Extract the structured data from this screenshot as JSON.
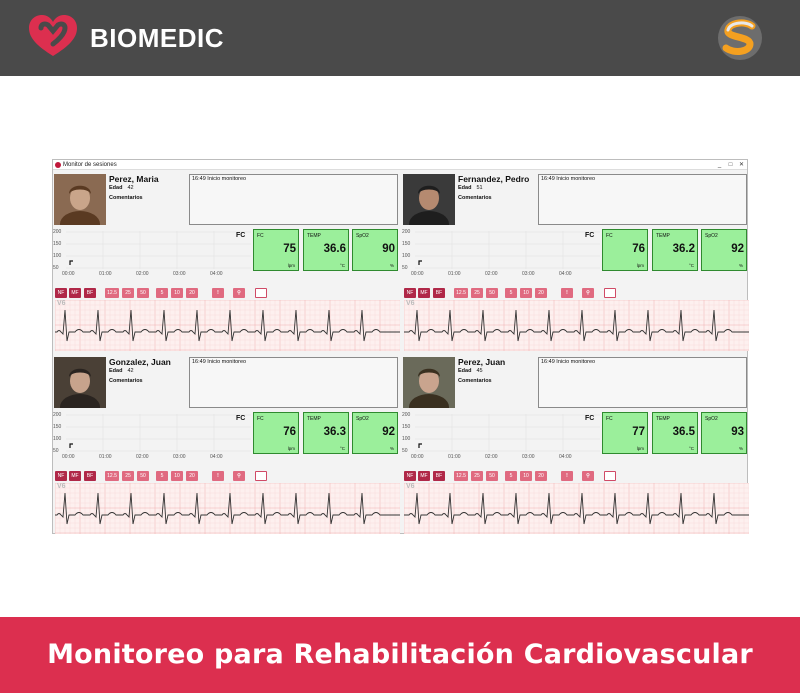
{
  "brand": {
    "name": "BIOMEDIC",
    "color": "#dc2f4f"
  },
  "footer": {
    "text": "Monitoreo para Rehabilitación Cardiovascular"
  },
  "window": {
    "title": "Monitor de sesiones",
    "minimize": "_",
    "maximize": "□",
    "close": "✕"
  },
  "panel_labels": {
    "age_label": "Edad",
    "comments_label": "Comentarios",
    "fc_title": "FC",
    "y_ticks": [
      "200",
      "150",
      "100",
      "50"
    ],
    "x_ticks": [
      "00:00",
      "01:00",
      "02:00",
      "03:00",
      "04:00"
    ],
    "vital_fc": {
      "label": "FC",
      "unit": "lpm"
    },
    "vital_temp": {
      "label": "TEMP",
      "unit": "°C"
    },
    "vital_spo2": {
      "label": "SpO2",
      "unit": "%"
    },
    "ecg_lead": "V6",
    "toolbar": [
      "NF",
      "MF",
      "BF",
      "12.5",
      "25",
      "50",
      "5",
      "10",
      "20",
      "!",
      "⚲",
      ""
    ]
  },
  "patients": [
    {
      "name": "Perez, Maria",
      "age": "42",
      "log": "16:49 Inicio monitoreo",
      "fc": "75",
      "temp": "36.6",
      "spo2": "90"
    },
    {
      "name": "Fernandez, Pedro",
      "age": "51",
      "log": "16:49 Inicio monitoreo",
      "fc": "76",
      "temp": "36.2",
      "spo2": "92"
    },
    {
      "name": "Gonzalez, Juan",
      "age": "42",
      "log": "16:49 Inicio monitoreo",
      "fc": "76",
      "temp": "36.3",
      "spo2": "92"
    },
    {
      "name": "Perez, Juan",
      "age": "45",
      "log": "16:49 Inicio monitoreo",
      "fc": "77",
      "temp": "36.5",
      "spo2": "93"
    }
  ],
  "icons": {
    "brand_logo": "biomedic-heart-logo-icon",
    "partner_logo": "partner-s-logo-icon",
    "alarm": "alert-icon",
    "marker": "marker-icon",
    "blank": "blank-square-icon"
  },
  "colors": {
    "vital_bg": "#9bef9b",
    "toolbar_dark": "#b02848",
    "toolbar_light": "#e06a80",
    "ecg_grid": "#f2b8b8"
  }
}
